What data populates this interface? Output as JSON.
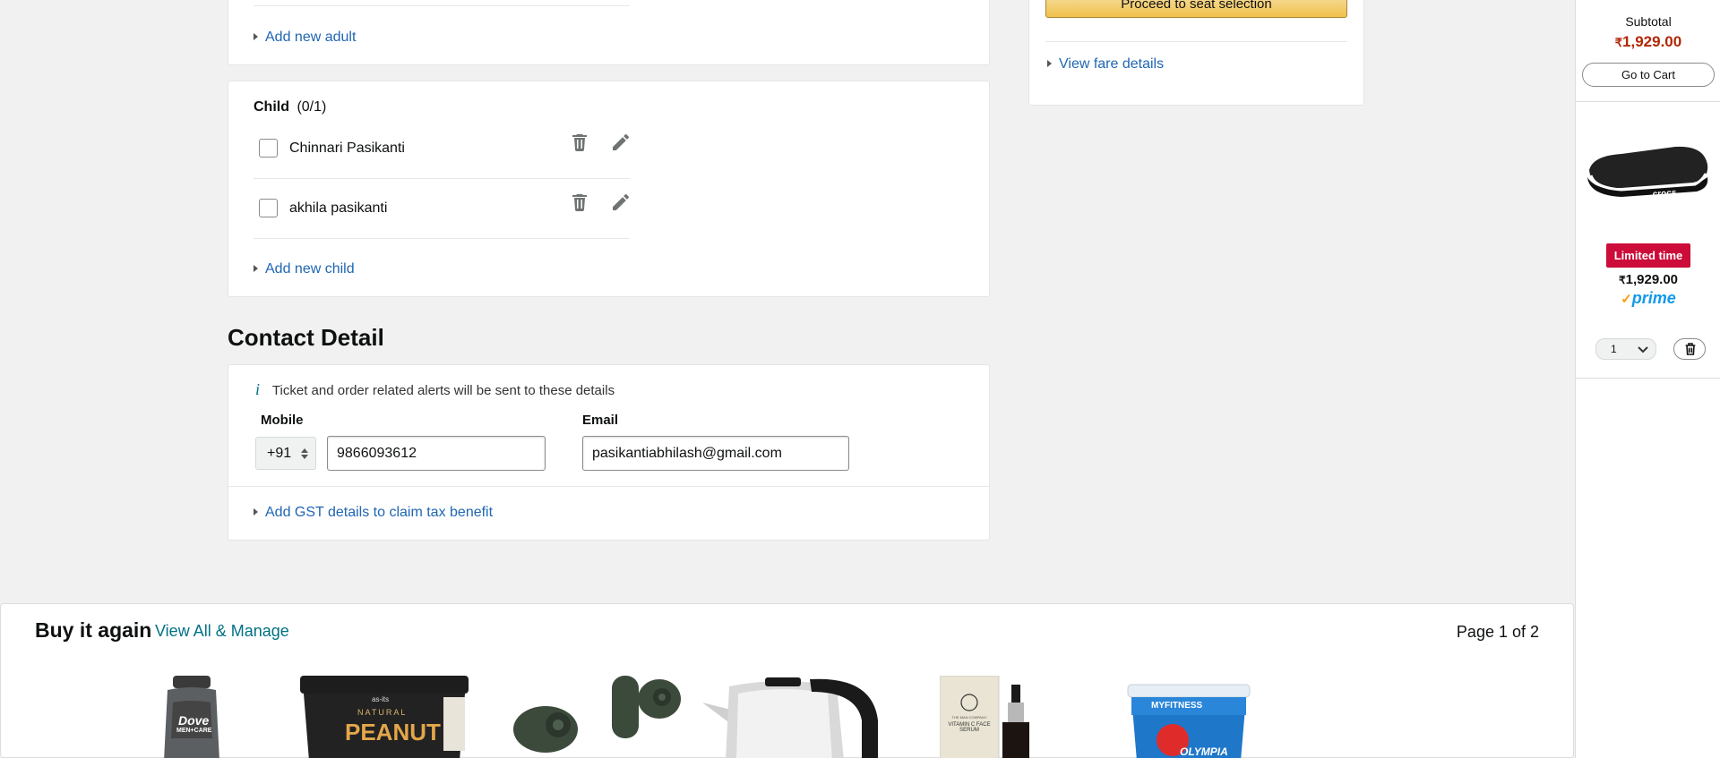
{
  "adults": {
    "add_link": "Add new adult"
  },
  "children": {
    "heading": "Child",
    "count": "(0/1)",
    "items": [
      {
        "name": "Chinnari Pasikanti"
      },
      {
        "name": "akhila pasikanti"
      }
    ],
    "add_link": "Add new child"
  },
  "contact": {
    "title": "Contact Detail",
    "info": "Ticket and order related alerts will be sent to these details",
    "info_icon": "i",
    "mobile_label": "Mobile",
    "country_code": "+91",
    "mobile_value": "9866093612",
    "email_label": "Email",
    "email_value": "pasikantiabhilash@gmail.com",
    "gst_link": "Add GST details to claim tax benefit"
  },
  "summary": {
    "proceed_button": "Proceed to seat selection",
    "fare_link": "View fare details"
  },
  "cart_sidebar": {
    "subtotal_label": "Subtotal",
    "subtotal_value": "1,929.00",
    "currency": "₹",
    "go_to_cart": "Go to Cart",
    "item": {
      "badge": "Limited time",
      "price": "1,929.00",
      "prime": "prime",
      "qty": "1"
    }
  },
  "buy_again": {
    "title": "Buy it again",
    "view_all": "View All & Manage",
    "page_indicator": "Page 1 of 2",
    "products": [
      {
        "label_1": "Dove",
        "label_2": "MEN+CARE"
      },
      {
        "label_1": "NATURAL",
        "label_2": "PEANUT",
        "brand": "as-its"
      },
      {
        "name": "earbuds"
      },
      {
        "name": "kettle"
      },
      {
        "label_1": "THE MAN COMPANY",
        "label_2": "VITAMIN C FACE SERUM"
      },
      {
        "label_1": "MYFITNESS",
        "label_2": "OLYMPIA"
      }
    ]
  },
  "colors": {
    "link": "#1f66b3",
    "price_red": "#b12704",
    "badge_red": "#cc0c39",
    "prime_blue": "#1399e8"
  }
}
